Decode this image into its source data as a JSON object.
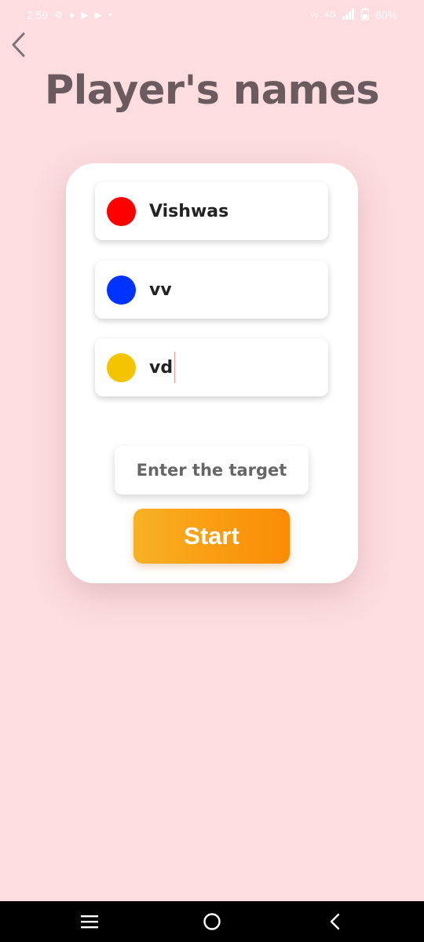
{
  "status_bar": {
    "time": "2:59",
    "network": "4G",
    "battery": "60%",
    "left_icons": [
      "settings-icon",
      "location-icon",
      "youtube-icon",
      "youtube-icon",
      "dot-icon"
    ],
    "right_icons": [
      "volte-icon",
      "data-speed-icon",
      "signal-icon",
      "battery-icon"
    ]
  },
  "header": {
    "back_icon": "chevron-left-icon",
    "title": "Player's names"
  },
  "players": [
    {
      "name": "Vishwas",
      "color": "#ff0000"
    },
    {
      "name": "vv",
      "color": "#0033ff"
    },
    {
      "name": "vd",
      "color": "#f5c400"
    }
  ],
  "target": {
    "placeholder": "Enter the target"
  },
  "start_button": {
    "label": "Start"
  },
  "nav_bar": {
    "recent_icon": "menu-lines-icon",
    "home_icon": "circle-home-icon",
    "back_icon": "chevron-left-icon"
  }
}
